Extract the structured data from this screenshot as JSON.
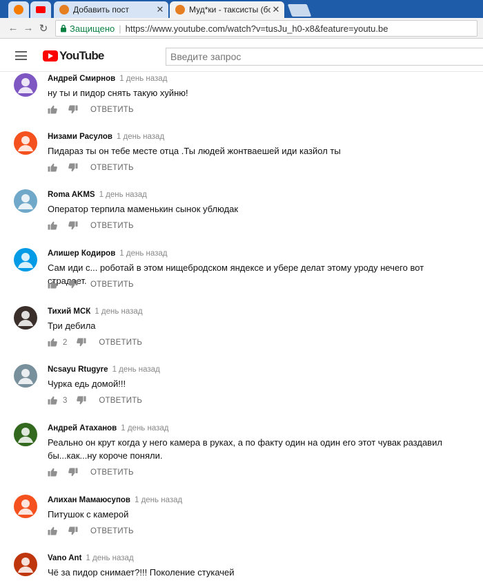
{
  "browser": {
    "tabs": [
      {
        "title": "",
        "kind": "pinned",
        "color": "#f57c00"
      },
      {
        "title": "",
        "kind": "pinned",
        "color": "#ff0000"
      },
      {
        "title": "Добавить пост",
        "kind": "normal",
        "color": "#e67e22"
      },
      {
        "title": "Муд*ки - таксисты (бомб",
        "kind": "active",
        "color": "#e67e22"
      }
    ],
    "secure_label": "Защищено",
    "url": "https://www.youtube.com/watch?v=tusJu_h0-x8&feature=youtu.be"
  },
  "youtube": {
    "logo_text": "YouTube",
    "search_placeholder": "Введите запрос"
  },
  "comments": [
    {
      "author": "Андрей Смирнов",
      "time": "1 день назад",
      "text": "ну ты и пидор снять такую хуйню!",
      "likes": "",
      "reply": "ОТВЕТИТЬ",
      "avatar_color": "#7e57c2"
    },
    {
      "author": "Низами Расулов",
      "time": "1 день назад",
      "text": "Пидараз ты он тебе месте отца .Ты людей жонтваешей иди казйол ты",
      "likes": "",
      "reply": "ОТВЕТИТЬ",
      "avatar_color": "#f4511e"
    },
    {
      "author": "Roma AKMS",
      "time": "1 день назад",
      "text": "Оператор терпила маменькин сынок ублюдак",
      "likes": "",
      "reply": "ОТВЕТИТЬ",
      "avatar_color": "#6fa8c8"
    },
    {
      "author": "Алишер Кодиров",
      "time": "1 день назад",
      "text": "Сам иди с... роботай в этом нищебродском яндексе и убере делат этому уроду нечего вот страдает.",
      "likes": "",
      "reply": "ОТВЕТИТЬ",
      "avatar_color": "#039be5"
    },
    {
      "author": "Тихий МСК",
      "time": "1 день назад",
      "text": "Три дебила",
      "likes": "2",
      "reply": "ОТВЕТИТЬ",
      "avatar_color": "#3a2f2a"
    },
    {
      "author": "Ncsayu Rtugyre",
      "time": "1 день назад",
      "text": "Чурка едь домой!!!",
      "likes": "3",
      "reply": "ОТВЕТИТЬ",
      "avatar_color": "#78909c"
    },
    {
      "author": "Андрей Атаханов",
      "time": "1 день назад",
      "text": "Реально он крут когда у него камера в руках, а по факту один на один его этот чувак раздавил бы...как...ну короче поняли.",
      "likes": "",
      "reply": "ОТВЕТИТЬ",
      "avatar_color": "#33691e"
    },
    {
      "author": "Алихан Мамаюсупов",
      "time": "1 день назад",
      "text": "Питушок с камерой",
      "likes": "",
      "reply": "ОТВЕТИТЬ",
      "avatar_color": "#f4511e"
    },
    {
      "author": "Vano Ant",
      "time": "1 день назад",
      "text": "Чё за пидор снимает?!!! Поколение стукачей",
      "likes": "",
      "reply": "",
      "avatar_color": "#bf360c"
    }
  ]
}
